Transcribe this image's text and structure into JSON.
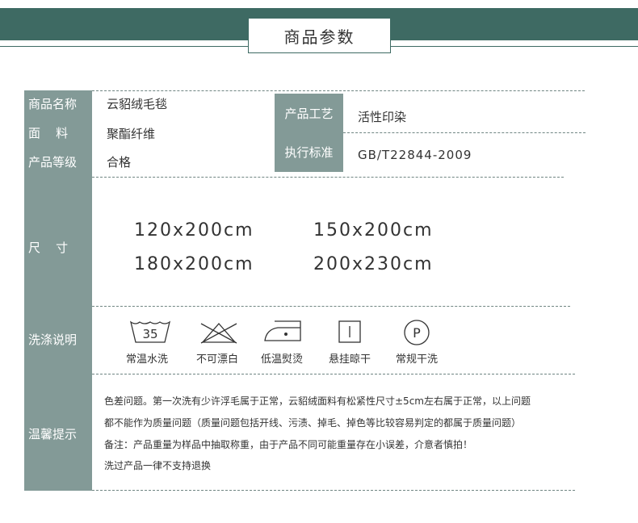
{
  "header": {
    "title": "商品参数"
  },
  "params": {
    "name_label": "商品名称",
    "name_value": "云貂绒毛毯",
    "material_label": "面    料",
    "material_value": "聚酯纤维",
    "grade_label": "产品等级",
    "grade_value": "合格",
    "process_label": "产品工艺",
    "process_value": "活性印染",
    "standard_label": "执行标准",
    "standard_value": "GB/T22844-2009"
  },
  "size": {
    "label": "尺    寸",
    "values": [
      "120x200cm",
      "150x200cm",
      "180x200cm",
      "200x230cm"
    ]
  },
  "wash": {
    "label": "洗涤说明",
    "icons": [
      {
        "icon": "wash-tub-icon",
        "symbol": "35",
        "caption": "常温水洗"
      },
      {
        "icon": "no-bleach-icon",
        "caption": "不可漂白"
      },
      {
        "icon": "iron-low-icon",
        "caption": "低温熨烫"
      },
      {
        "icon": "hang-dry-icon",
        "caption": "悬挂晾干"
      },
      {
        "icon": "dry-clean-icon",
        "symbol": "P",
        "caption": "常规干洗"
      }
    ]
  },
  "tips": {
    "label": "温馨提示",
    "lines": [
      "色差问题。第一次洗有少许浮毛属于正常，云貂绒面料有松紧性尺寸±5cm左右属于正常，以上问题",
      "都不能作为质量问题（质量问题包括开线、污渍、掉毛、掉色等比较容易判定的都属于质量问题）",
      "备注：产品重量为样品中抽取称重，由于产品不同可能重量存在小误差，介意者慎拍！",
      "洗过产品一律不支持退换"
    ]
  },
  "colors": {
    "band": "#3e6a63",
    "label_bg": "#839a97"
  }
}
